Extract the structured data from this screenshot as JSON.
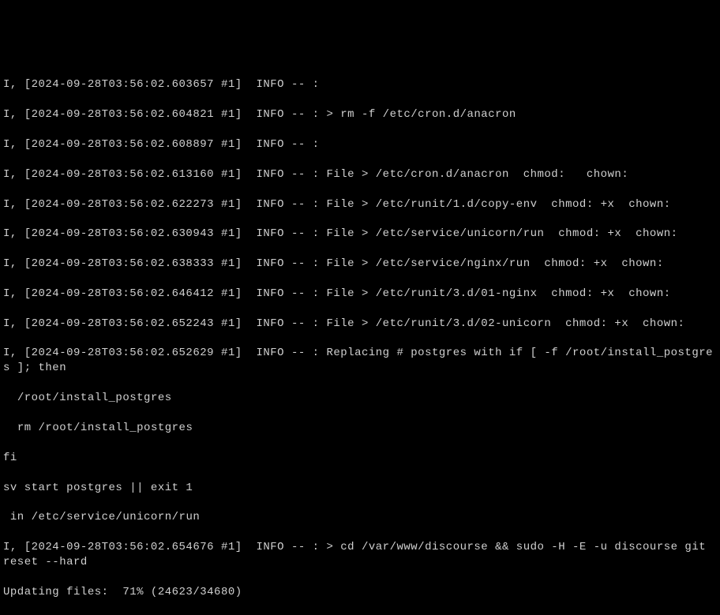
{
  "terminal": {
    "lines": [
      "I, [2024-09-28T03:56:02.603657 #1]  INFO -- :",
      "I, [2024-09-28T03:56:02.604821 #1]  INFO -- : > rm -f /etc/cron.d/anacron",
      "I, [2024-09-28T03:56:02.608897 #1]  INFO -- :",
      "I, [2024-09-28T03:56:02.613160 #1]  INFO -- : File > /etc/cron.d/anacron  chmod:   chown:",
      "I, [2024-09-28T03:56:02.622273 #1]  INFO -- : File > /etc/runit/1.d/copy-env  chmod: +x  chown:",
      "I, [2024-09-28T03:56:02.630943 #1]  INFO -- : File > /etc/service/unicorn/run  chmod: +x  chown:",
      "I, [2024-09-28T03:56:02.638333 #1]  INFO -- : File > /etc/service/nginx/run  chmod: +x  chown:",
      "I, [2024-09-28T03:56:02.646412 #1]  INFO -- : File > /etc/runit/3.d/01-nginx  chmod: +x  chown:",
      "I, [2024-09-28T03:56:02.652243 #1]  INFO -- : File > /etc/runit/3.d/02-unicorn  chmod: +x  chown:",
      "I, [2024-09-28T03:56:02.652629 #1]  INFO -- : Replacing # postgres with if [ -f /root/install_postgres ]; then",
      "  /root/install_postgres",
      "  rm /root/install_postgres",
      "fi",
      "sv start postgres || exit 1",
      " in /etc/service/unicorn/run",
      "I, [2024-09-28T03:56:02.654676 #1]  INFO -- : > cd /var/www/discourse && sudo -H -E -u discourse git reset --hard",
      "Updating files:  71% (24623/34680)"
    ]
  }
}
